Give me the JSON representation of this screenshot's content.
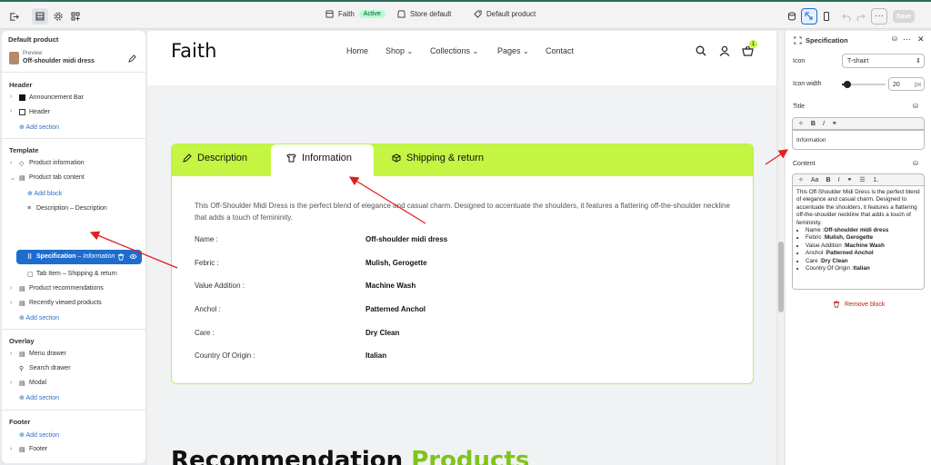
{
  "topbar": {
    "exit_icon": "exit-icon",
    "store": "Faith",
    "store_status": "Active",
    "store_default": "Store default",
    "product_template": "Default product",
    "save_label": "Save"
  },
  "left_panel": {
    "title": "Default product",
    "preview_label": "Preview",
    "preview_product": "Off-shoulder midi dress",
    "header_section": "Header",
    "header_items": [
      "Announcement Bar",
      "Header"
    ],
    "add_section": "Add section",
    "template_section": "Template",
    "template_items": {
      "product_information": "Product information",
      "product_tab_content": "Product tab content",
      "add_block": "Add block",
      "description": "Description",
      "description_sub": "– Description",
      "specification": "Specification",
      "specification_sub": "– Information",
      "tab_item": "Tab Item",
      "tab_item_sub": "– Shipping & return",
      "product_recommendations": "Product recommendations",
      "recently_viewed": "Recently viewed products"
    },
    "overlay_section": "Overlay",
    "overlay_items": [
      "Menu drawer",
      "Search drawer",
      "Modal"
    ],
    "footer_section": "Footer",
    "footer_items": [
      "Footer"
    ]
  },
  "preview": {
    "logo": "Faith",
    "nav": [
      "Home",
      "Shop",
      "Collections",
      "Pages",
      "Contact"
    ],
    "cart_count": "1",
    "tabs": [
      "Description",
      "Information",
      "Shipping & return"
    ],
    "description": "This Off-Shoulder Midi Dress is the perfect blend of elegance and casual charm. Designed to accentuate the shoulders, it features a flattering off-the-shoulder neckline that adds a touch of femininity.",
    "rows": [
      {
        "label": "Name :",
        "value": "Off-shoulder midi dress"
      },
      {
        "label": "Febric :",
        "value": "Mulish, Gerogette"
      },
      {
        "label": "Value Addition :",
        "value": "Machine Wash"
      },
      {
        "label": "Anchol :",
        "value": "Patterned Anchol"
      },
      {
        "label": "Care :",
        "value": "Dry Clean"
      },
      {
        "label": "Country Of Origin :",
        "value": "Italian"
      }
    ],
    "recommendation_black": "Recommendation",
    "recommendation_green": "Products"
  },
  "right_panel": {
    "title": "Specification",
    "icon_label": "Icon",
    "icon_value": "T-shairt",
    "icon_width_label": "Icon width",
    "icon_width_value": "20",
    "icon_width_unit": "px",
    "icon_width_level": 0.12,
    "title_label": "Title",
    "title_value": "Information",
    "content_label": "Content",
    "content_paragraph": "This Off-Shoulder Midi Dress is the perfect blend of elegance and casual charm. Designed to accentuate the shoulders, it features a flattering off-the-shoulder neckline that adds a touch of femininity.",
    "content_list": [
      {
        "k": "Name :",
        "v": "Off-shoulder midi dress"
      },
      {
        "k": "Febric :",
        "v": "Mulish, Gerogette"
      },
      {
        "k": "Value Addition :",
        "v": "Machine Wash"
      },
      {
        "k": "Anchol :",
        "v": "Patterned Anchol"
      },
      {
        "k": "Care :",
        "v": "Dry Clean"
      },
      {
        "k": "Country Of Origin :",
        "v": "Italian"
      }
    ],
    "font_size_label": "Aa",
    "remove_block": "Remove block"
  },
  "colors": {
    "accent_green": "#c4f542",
    "selection_blue": "#1f6ccf",
    "annotation_red": "#e02020",
    "link_blue": "#2c6ecb",
    "danger_red": "#b42318"
  }
}
